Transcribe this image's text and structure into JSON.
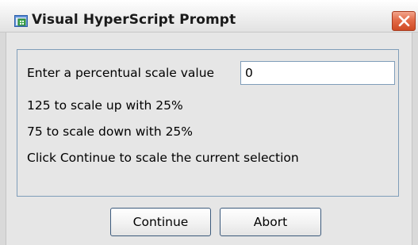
{
  "window": {
    "title": "Visual HyperScript Prompt"
  },
  "prompt": {
    "label": "Enter a percentual scale value",
    "input_value": "0",
    "hint_up": "125 to scale up with 25%",
    "hint_down": "75 to scale down with 25%",
    "hint_continue": "Click Continue to scale the current selection"
  },
  "buttons": {
    "continue_label": "Continue",
    "abort_label": "Abort"
  },
  "icons": {
    "app": "app-icon",
    "close": "close-icon"
  },
  "colors": {
    "close_button": "#e36b48",
    "border_accent": "#7f9db9",
    "dialog_background": "#e6e6e6"
  }
}
